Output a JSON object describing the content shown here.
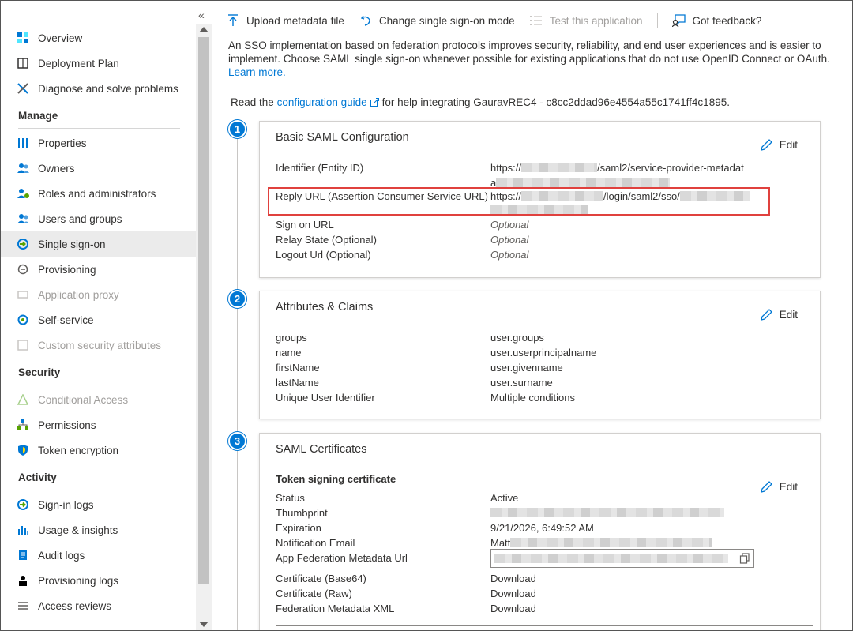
{
  "sidebar": {
    "collapse_glyph": "«",
    "items_top": [
      {
        "label": "Overview",
        "icon": "overview-icon"
      },
      {
        "label": "Deployment Plan",
        "icon": "book-icon"
      },
      {
        "label": "Diagnose and solve problems",
        "icon": "wrench-icon"
      }
    ],
    "sections": [
      {
        "title": "Manage",
        "items": [
          {
            "label": "Properties",
            "icon": "properties-icon"
          },
          {
            "label": "Owners",
            "icon": "owners-icon"
          },
          {
            "label": "Roles and administrators",
            "icon": "roles-icon"
          },
          {
            "label": "Users and groups",
            "icon": "users-icon"
          },
          {
            "label": "Single sign-on",
            "icon": "sso-icon",
            "selected": true
          },
          {
            "label": "Provisioning",
            "icon": "provisioning-icon"
          },
          {
            "label": "Application proxy",
            "icon": "proxy-icon",
            "disabled": true
          },
          {
            "label": "Self-service",
            "icon": "self-service-icon"
          },
          {
            "label": "Custom security attributes",
            "icon": "custom-attributes-icon",
            "disabled": true
          }
        ]
      },
      {
        "title": "Security",
        "items": [
          {
            "label": "Conditional Access",
            "icon": "conditional-access-icon",
            "disabled": true
          },
          {
            "label": "Permissions",
            "icon": "permissions-icon"
          },
          {
            "label": "Token encryption",
            "icon": "shield-icon"
          }
        ]
      },
      {
        "title": "Activity",
        "items": [
          {
            "label": "Sign-in logs",
            "icon": "sign-in-icon"
          },
          {
            "label": "Usage & insights",
            "icon": "chart-icon"
          },
          {
            "label": "Audit logs",
            "icon": "audit-icon"
          },
          {
            "label": "Provisioning logs",
            "icon": "person-icon"
          },
          {
            "label": "Access reviews",
            "icon": "list-icon"
          }
        ]
      }
    ]
  },
  "toolbar": {
    "upload": "Upload metadata file",
    "change_mode": "Change single sign-on mode",
    "test": "Test this application",
    "feedback": "Got feedback?"
  },
  "intro": {
    "text": "An SSO implementation based on federation protocols improves security, reliability, and end user experiences and is easier to implement. Choose SAML single sign-on whenever possible for existing applications that do not use OpenID Connect or OAuth.",
    "learn_more": "Learn more."
  },
  "guide": {
    "prefix": "Read the",
    "link": "configuration guide",
    "suffix": "for help integrating GauravREC4 - c8cc2ddad96e4554a55c1741ff4c1895."
  },
  "steps": [
    "1",
    "2",
    "3"
  ],
  "edit_label": "Edit",
  "basic_saml": {
    "title": "Basic SAML Configuration",
    "identifier_label": "Identifier (Entity ID)",
    "identifier_prefix": "https://",
    "identifier_suffix": "/saml2/service-provider-metadat",
    "identifier_line2": "a",
    "reply_label": "Reply URL (Assertion Consumer Service URL)",
    "reply_prefix": "https://",
    "reply_suffix": "/login/saml2/sso/",
    "sign_on_label": "Sign on URL",
    "sign_on_value": "Optional",
    "relay_label": "Relay State (Optional)",
    "relay_value": "Optional",
    "logout_label": "Logout Url (Optional)",
    "logout_value": "Optional"
  },
  "attributes": {
    "title": "Attributes & Claims",
    "rows": [
      {
        "k": "groups",
        "v": "user.groups"
      },
      {
        "k": "name",
        "v": "user.userprincipalname"
      },
      {
        "k": "firstName",
        "v": "user.givenname"
      },
      {
        "k": "lastName",
        "v": "user.surname"
      },
      {
        "k": "Unique User Identifier",
        "v": "Multiple conditions"
      }
    ]
  },
  "certificates": {
    "title": "SAML Certificates",
    "subtitle": "Token signing certificate",
    "status_label": "Status",
    "status_value": "Active",
    "thumbprint_label": "Thumbprint",
    "expiration_label": "Expiration",
    "expiration_value": "9/21/2026, 6:49:52 AM",
    "email_label": "Notification Email",
    "email_prefix": "Matt",
    "metadata_url_label": "App Federation Metadata Url",
    "base64_label": "Certificate (Base64)",
    "raw_label": "Certificate (Raw)",
    "xml_label": "Federation Metadata XML",
    "download": "Download"
  },
  "colors": {
    "accent": "#0078d4",
    "highlight": "#e0413e",
    "selected_bg": "#ebebeb"
  }
}
